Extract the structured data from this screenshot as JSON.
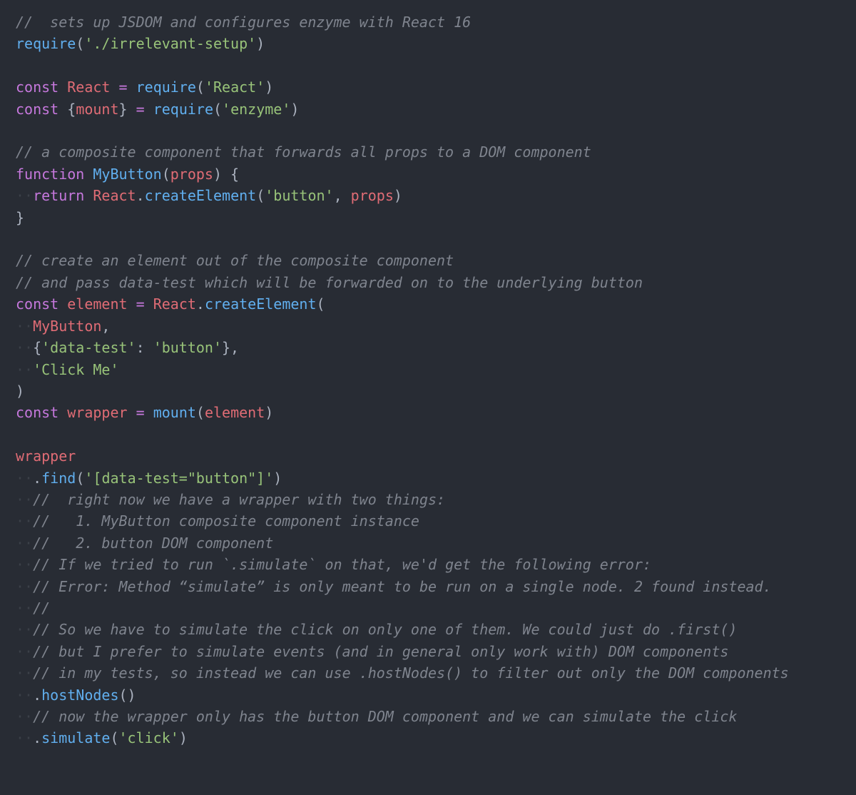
{
  "code": {
    "lines": [
      [
        {
          "cls": "tok-comment",
          "t": "//  sets up JSDOM and configures enzyme with React 16"
        }
      ],
      [
        {
          "cls": "tok-func",
          "t": "require"
        },
        {
          "cls": "tok-plain",
          "t": "("
        },
        {
          "cls": "tok-string",
          "t": "'./irrelevant-setup'"
        },
        {
          "cls": "tok-plain",
          "t": ")"
        }
      ],
      [],
      [
        {
          "cls": "tok-keyword",
          "t": "const"
        },
        {
          "cls": "tok-plain",
          "t": " "
        },
        {
          "cls": "tok-ident",
          "t": "React"
        },
        {
          "cls": "tok-plain",
          "t": " "
        },
        {
          "cls": "tok-keyword",
          "t": "="
        },
        {
          "cls": "tok-plain",
          "t": " "
        },
        {
          "cls": "tok-func",
          "t": "require"
        },
        {
          "cls": "tok-plain",
          "t": "("
        },
        {
          "cls": "tok-string",
          "t": "'React'"
        },
        {
          "cls": "tok-plain",
          "t": ")"
        }
      ],
      [
        {
          "cls": "tok-keyword",
          "t": "const"
        },
        {
          "cls": "tok-plain",
          "t": " {"
        },
        {
          "cls": "tok-ident",
          "t": "mount"
        },
        {
          "cls": "tok-plain",
          "t": "} "
        },
        {
          "cls": "tok-keyword",
          "t": "="
        },
        {
          "cls": "tok-plain",
          "t": " "
        },
        {
          "cls": "tok-func",
          "t": "require"
        },
        {
          "cls": "tok-plain",
          "t": "("
        },
        {
          "cls": "tok-string",
          "t": "'enzyme'"
        },
        {
          "cls": "tok-plain",
          "t": ")"
        }
      ],
      [],
      [
        {
          "cls": "tok-comment",
          "t": "// a composite component that forwards all props to a DOM component"
        }
      ],
      [
        {
          "cls": "tok-keyword",
          "t": "function"
        },
        {
          "cls": "tok-plain",
          "t": " "
        },
        {
          "cls": "tok-func",
          "t": "MyButton"
        },
        {
          "cls": "tok-plain",
          "t": "("
        },
        {
          "cls": "tok-ident",
          "t": "props"
        },
        {
          "cls": "tok-plain",
          "t": ") {"
        }
      ],
      [
        {
          "cls": "tok-ws",
          "t": "··"
        },
        {
          "cls": "tok-keyword",
          "t": "return"
        },
        {
          "cls": "tok-plain",
          "t": " "
        },
        {
          "cls": "tok-ident",
          "t": "React"
        },
        {
          "cls": "tok-plain",
          "t": "."
        },
        {
          "cls": "tok-func",
          "t": "createElement"
        },
        {
          "cls": "tok-plain",
          "t": "("
        },
        {
          "cls": "tok-string",
          "t": "'button'"
        },
        {
          "cls": "tok-plain",
          "t": ", "
        },
        {
          "cls": "tok-ident",
          "t": "props"
        },
        {
          "cls": "tok-plain",
          "t": ")"
        }
      ],
      [
        {
          "cls": "tok-plain",
          "t": "}"
        }
      ],
      [],
      [
        {
          "cls": "tok-comment",
          "t": "// create an element out of the composite component"
        }
      ],
      [
        {
          "cls": "tok-comment",
          "t": "// and pass data-test which will be forwarded on to the underlying button"
        }
      ],
      [
        {
          "cls": "tok-keyword",
          "t": "const"
        },
        {
          "cls": "tok-plain",
          "t": " "
        },
        {
          "cls": "tok-ident",
          "t": "element"
        },
        {
          "cls": "tok-plain",
          "t": " "
        },
        {
          "cls": "tok-keyword",
          "t": "="
        },
        {
          "cls": "tok-plain",
          "t": " "
        },
        {
          "cls": "tok-ident",
          "t": "React"
        },
        {
          "cls": "tok-plain",
          "t": "."
        },
        {
          "cls": "tok-func",
          "t": "createElement"
        },
        {
          "cls": "tok-plain",
          "t": "("
        }
      ],
      [
        {
          "cls": "tok-ws",
          "t": "··"
        },
        {
          "cls": "tok-ident",
          "t": "MyButton"
        },
        {
          "cls": "tok-plain",
          "t": ","
        }
      ],
      [
        {
          "cls": "tok-ws",
          "t": "··"
        },
        {
          "cls": "tok-plain",
          "t": "{"
        },
        {
          "cls": "tok-string",
          "t": "'data-test'"
        },
        {
          "cls": "tok-plain",
          "t": ": "
        },
        {
          "cls": "tok-string",
          "t": "'button'"
        },
        {
          "cls": "tok-plain",
          "t": "},"
        }
      ],
      [
        {
          "cls": "tok-ws",
          "t": "··"
        },
        {
          "cls": "tok-string",
          "t": "'Click Me'"
        }
      ],
      [
        {
          "cls": "tok-plain",
          "t": ")"
        }
      ],
      [
        {
          "cls": "tok-keyword",
          "t": "const"
        },
        {
          "cls": "tok-plain",
          "t": " "
        },
        {
          "cls": "tok-ident",
          "t": "wrapper"
        },
        {
          "cls": "tok-plain",
          "t": " "
        },
        {
          "cls": "tok-keyword",
          "t": "="
        },
        {
          "cls": "tok-plain",
          "t": " "
        },
        {
          "cls": "tok-func",
          "t": "mount"
        },
        {
          "cls": "tok-plain",
          "t": "("
        },
        {
          "cls": "tok-ident",
          "t": "element"
        },
        {
          "cls": "tok-plain",
          "t": ")"
        }
      ],
      [],
      [
        {
          "cls": "tok-ident",
          "t": "wrapper"
        }
      ],
      [
        {
          "cls": "tok-ws",
          "t": "··"
        },
        {
          "cls": "tok-plain",
          "t": "."
        },
        {
          "cls": "tok-func",
          "t": "find"
        },
        {
          "cls": "tok-plain",
          "t": "("
        },
        {
          "cls": "tok-string",
          "t": "'[data-test=\"button\"]'"
        },
        {
          "cls": "tok-plain",
          "t": ")"
        }
      ],
      [
        {
          "cls": "tok-ws",
          "t": "··"
        },
        {
          "cls": "tok-comment",
          "t": "//  right now we have a wrapper with two things:"
        }
      ],
      [
        {
          "cls": "tok-ws",
          "t": "··"
        },
        {
          "cls": "tok-comment",
          "t": "//   1. MyButton composite component instance"
        }
      ],
      [
        {
          "cls": "tok-ws",
          "t": "··"
        },
        {
          "cls": "tok-comment",
          "t": "//   2. button DOM component"
        }
      ],
      [
        {
          "cls": "tok-ws",
          "t": "··"
        },
        {
          "cls": "tok-comment",
          "t": "// If we tried to run `.simulate` on that, we'd get the following error:"
        }
      ],
      [
        {
          "cls": "tok-ws",
          "t": "··"
        },
        {
          "cls": "tok-comment",
          "t": "// Error: Method “simulate” is only meant to be run on a single node. 2 found instead."
        }
      ],
      [
        {
          "cls": "tok-ws",
          "t": "··"
        },
        {
          "cls": "tok-comment",
          "t": "//"
        }
      ],
      [
        {
          "cls": "tok-ws",
          "t": "··"
        },
        {
          "cls": "tok-comment",
          "t": "// So we have to simulate the click on only one of them. We could just do .first()"
        }
      ],
      [
        {
          "cls": "tok-ws",
          "t": "··"
        },
        {
          "cls": "tok-comment",
          "t": "// but I prefer to simulate events (and in general only work with) DOM components"
        }
      ],
      [
        {
          "cls": "tok-ws",
          "t": "··"
        },
        {
          "cls": "tok-comment",
          "t": "// in my tests, so instead we can use .hostNodes() to filter out only the DOM components"
        }
      ],
      [
        {
          "cls": "tok-ws",
          "t": "··"
        },
        {
          "cls": "tok-plain",
          "t": "."
        },
        {
          "cls": "tok-func",
          "t": "hostNodes"
        },
        {
          "cls": "tok-plain",
          "t": "()"
        }
      ],
      [
        {
          "cls": "tok-ws",
          "t": "··"
        },
        {
          "cls": "tok-comment",
          "t": "// now the wrapper only has the button DOM component and we can simulate the click"
        }
      ],
      [
        {
          "cls": "tok-ws",
          "t": "··"
        },
        {
          "cls": "tok-plain",
          "t": "."
        },
        {
          "cls": "tok-func",
          "t": "simulate"
        },
        {
          "cls": "tok-plain",
          "t": "("
        },
        {
          "cls": "tok-string",
          "t": "'click'"
        },
        {
          "cls": "tok-plain",
          "t": ")"
        }
      ]
    ]
  }
}
